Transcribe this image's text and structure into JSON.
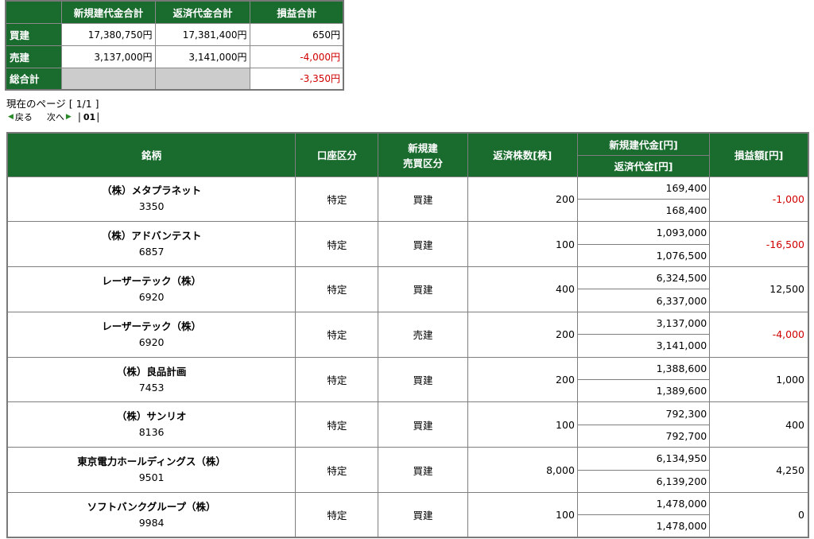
{
  "summary": {
    "headers": [
      "新規建代金合計",
      "返済代金合計",
      "損益合計"
    ],
    "rows": [
      {
        "label": "買建",
        "new_total": "17,380,750円",
        "repay_total": "17,381,400円",
        "pl": "650円",
        "pl_negative": false
      },
      {
        "label": "売建",
        "new_total": "3,137,000円",
        "repay_total": "3,141,000円",
        "pl": "-4,000円",
        "pl_negative": true
      },
      {
        "label": "総合計",
        "new_total": "",
        "repay_total": "",
        "pl": "-3,350円",
        "pl_negative": true
      }
    ]
  },
  "pager": {
    "current_page_text": "現在のページ [ 1/1 ]",
    "prev_label": "戻る",
    "next_label": "次へ",
    "page_link": "01"
  },
  "table": {
    "headers": {
      "stock": "銘柄",
      "account": "口座区分",
      "trade_type_line1": "新規建",
      "trade_type_line2": "売買区分",
      "shares": "返済株数[株]",
      "new_amount": "新規建代金[円]",
      "repay_amount": "返済代金[円]",
      "pl": "損益額[円]"
    },
    "rows": [
      {
        "name": "（株）メタプラネット",
        "code": "3350",
        "account": "特定",
        "side": "買建",
        "shares": "200",
        "new_amount": "169,400",
        "repay_amount": "168,400",
        "pl": "-1,000",
        "pl_negative": true
      },
      {
        "name": "（株）アドバンテスト",
        "code": "6857",
        "account": "特定",
        "side": "買建",
        "shares": "100",
        "new_amount": "1,093,000",
        "repay_amount": "1,076,500",
        "pl": "-16,500",
        "pl_negative": true
      },
      {
        "name": "レーザーテック（株）",
        "code": "6920",
        "account": "特定",
        "side": "買建",
        "shares": "400",
        "new_amount": "6,324,500",
        "repay_amount": "6,337,000",
        "pl": "12,500",
        "pl_negative": false
      },
      {
        "name": "レーザーテック（株）",
        "code": "6920",
        "account": "特定",
        "side": "売建",
        "shares": "200",
        "new_amount": "3,137,000",
        "repay_amount": "3,141,000",
        "pl": "-4,000",
        "pl_negative": true
      },
      {
        "name": "（株）良品計画",
        "code": "7453",
        "account": "特定",
        "side": "買建",
        "shares": "200",
        "new_amount": "1,388,600",
        "repay_amount": "1,389,600",
        "pl": "1,000",
        "pl_negative": false
      },
      {
        "name": "（株）サンリオ",
        "code": "8136",
        "account": "特定",
        "side": "買建",
        "shares": "100",
        "new_amount": "792,300",
        "repay_amount": "792,700",
        "pl": "400",
        "pl_negative": false
      },
      {
        "name": "東京電力ホールディングス（株）",
        "code": "9501",
        "account": "特定",
        "side": "買建",
        "shares": "8,000",
        "new_amount": "6,134,950",
        "repay_amount": "6,139,200",
        "pl": "4,250",
        "pl_negative": false
      },
      {
        "name": "ソフトバンクグループ（株）",
        "code": "9984",
        "account": "特定",
        "side": "買建",
        "shares": "100",
        "new_amount": "1,478,000",
        "repay_amount": "1,478,000",
        "pl": "0",
        "pl_negative": false
      }
    ]
  },
  "colors": {
    "header_green": "#1a6b2e",
    "negative_red": "#d00000",
    "blank_cell_gray": "#cccccc"
  }
}
